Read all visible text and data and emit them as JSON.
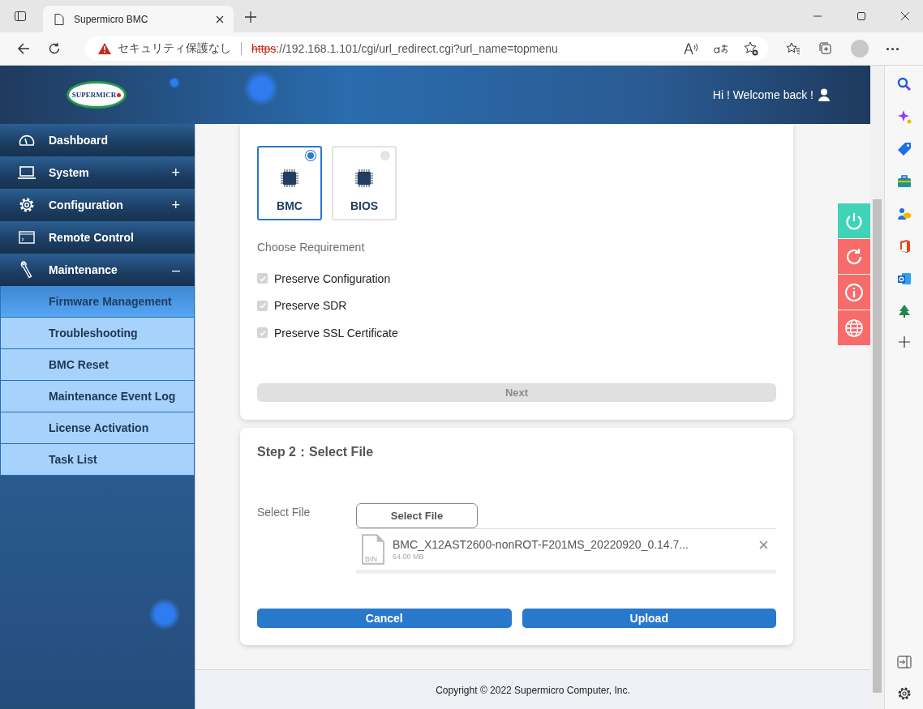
{
  "browser": {
    "tab_title": "Supermicro BMC",
    "security": "セキュリティ保護なし",
    "url_scheme": "https",
    "url_rest": "://192.168.1.101/cgi/url_redirect.cgi?url_name=topmenu"
  },
  "header": {
    "logo_text": "SUPERMICR",
    "greeting": "Hi ! Welcome back !"
  },
  "nav": [
    {
      "label": "Dashboard",
      "kind": "dashboard"
    },
    {
      "label": "System",
      "kind": "system",
      "expander": "+"
    },
    {
      "label": "Configuration",
      "kind": "configuration",
      "expander": "+"
    },
    {
      "label": "Remote Control",
      "kind": "remote"
    },
    {
      "label": "Maintenance",
      "kind": "maintenance",
      "expander": "–",
      "children": [
        {
          "label": "Firmware Management",
          "selected": true
        },
        {
          "label": "Troubleshooting",
          "selected": false
        },
        {
          "label": "BMC Reset",
          "selected": false
        },
        {
          "label": "Maintenance Event Log",
          "selected": false
        },
        {
          "label": "License Activation",
          "selected": false
        },
        {
          "label": "Task List",
          "selected": false
        }
      ]
    }
  ],
  "firmware": {
    "targets": [
      {
        "label": "BMC",
        "selected": true
      },
      {
        "label": "BIOS",
        "selected": false
      }
    ],
    "requirement_label": "Choose Requirement",
    "options": [
      {
        "label": "Preserve Configuration",
        "checked": true,
        "disabled": true
      },
      {
        "label": "Preserve SDR",
        "checked": true,
        "disabled": true
      },
      {
        "label": "Preserve SSL Certificate",
        "checked": true,
        "disabled": true
      }
    ],
    "next_button": {
      "label": "Next",
      "disabled": true
    }
  },
  "step2": {
    "title": "Step 2：Select File",
    "select_file_label": "Select File",
    "select_button": "Select File",
    "file": {
      "name": "BMC_X12AST2600-nonROT-F201MS_20220920_0.14.7...",
      "size": "64.00 MB",
      "type_label": "BIN"
    },
    "cancel_button": "Cancel",
    "upload_button": "Upload"
  },
  "footer": {
    "copyright": "Copyright © 2022 Supermicro Computer, Inc."
  },
  "side_actions": [
    {
      "kind": "power",
      "color": "#3fd3b8"
    },
    {
      "kind": "refresh",
      "color": "#f76b6b"
    },
    {
      "kind": "info",
      "color": "#f76b6b"
    },
    {
      "kind": "globe",
      "color": "#f76b6b"
    }
  ]
}
